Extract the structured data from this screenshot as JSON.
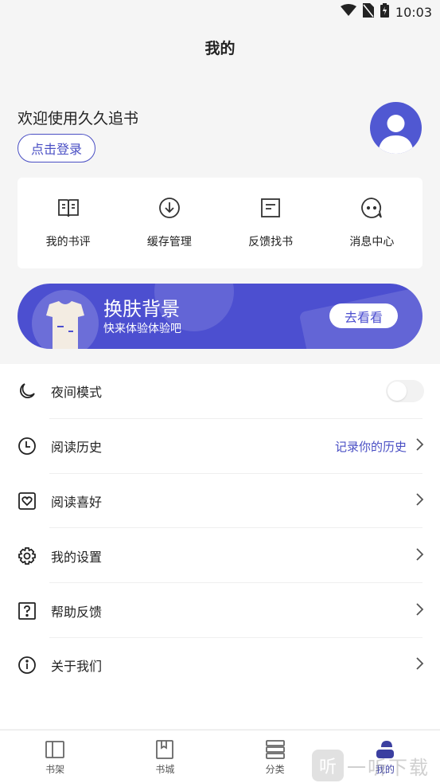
{
  "status_bar": {
    "time": "10:03"
  },
  "header": {
    "title": "我的"
  },
  "profile": {
    "welcome": "欢迎使用久久追书",
    "login_label": "点击登录"
  },
  "quick_actions": [
    {
      "label": "我的书评",
      "icon": "book-review-icon"
    },
    {
      "label": "缓存管理",
      "icon": "download-icon"
    },
    {
      "label": "反馈找书",
      "icon": "feedback-doc-icon"
    },
    {
      "label": "消息中心",
      "icon": "message-bubble-icon"
    }
  ],
  "banner": {
    "title": "换肤背景",
    "subtitle": "快来体验体验吧",
    "button": "去看看"
  },
  "menu": [
    {
      "label": "夜间模式",
      "icon": "moon-icon"
    },
    {
      "label": "阅读历史",
      "icon": "clock-icon",
      "extra": "记录你的历史"
    },
    {
      "label": "阅读喜好",
      "icon": "heart-frame-icon"
    },
    {
      "label": "我的设置",
      "icon": "gear-icon"
    },
    {
      "label": "帮助反馈",
      "icon": "question-icon"
    },
    {
      "label": "关于我们",
      "icon": "info-icon"
    }
  ],
  "tabs": [
    {
      "label": "书架",
      "icon": "bookshelf-icon"
    },
    {
      "label": "书城",
      "icon": "bookstore-icon"
    },
    {
      "label": "分类",
      "icon": "category-icon"
    },
    {
      "label": "我的",
      "icon": "profile-icon",
      "active": true
    }
  ],
  "watermark": {
    "mark": "听",
    "text": "一听下载"
  },
  "colors": {
    "accent": "#4c4fd0",
    "text": "#222222",
    "background": "#f5f5f5"
  }
}
